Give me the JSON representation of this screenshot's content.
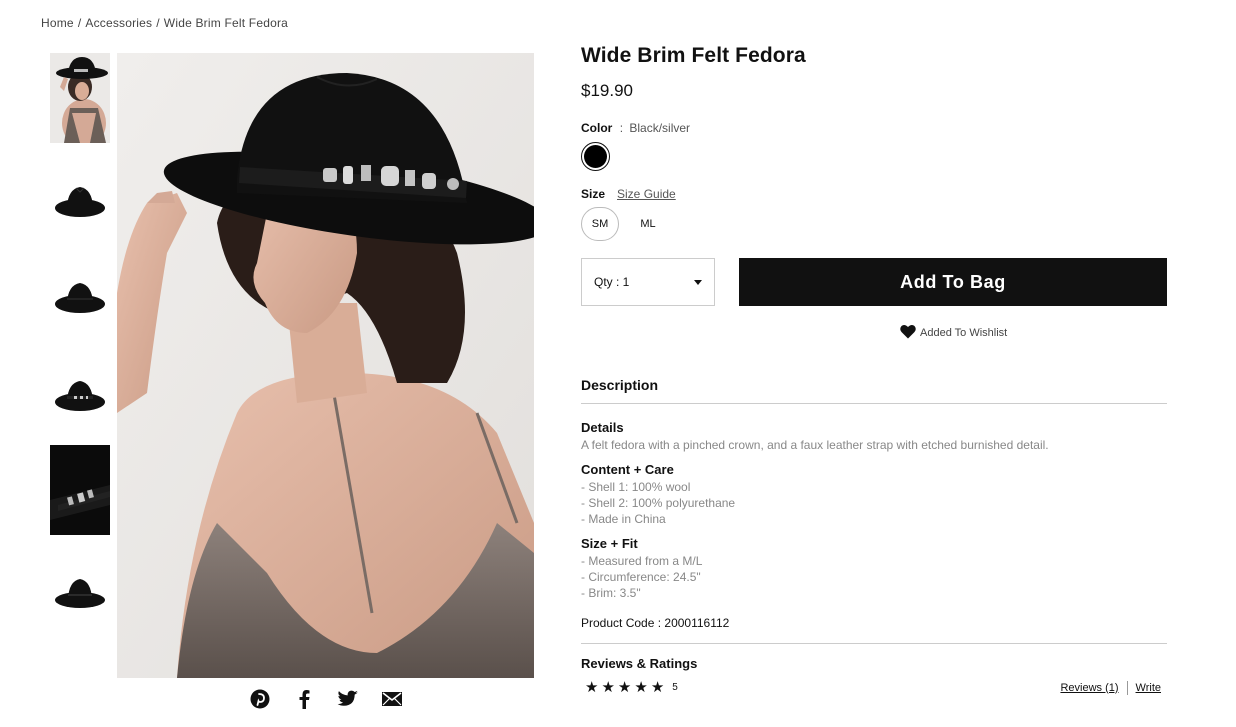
{
  "breadcrumb": {
    "items": [
      "Home",
      "Accessories",
      "Wide Brim Felt Fedora"
    ],
    "separator": "/"
  },
  "product": {
    "title": "Wide Brim Felt Fedora",
    "price": "$19.90",
    "color_label": "Color",
    "color_sep": ":",
    "color_value": "Black/silver",
    "swatch_color": "#000000",
    "size_label": "Size",
    "size_guide": "Size Guide",
    "sizes": [
      "SM",
      "ML"
    ],
    "selected_size": "SM",
    "qty_label": "Qty : 1",
    "add_to_bag": "Add To Bag",
    "wishlist": "Added To Wishlist"
  },
  "description": {
    "heading": "Description",
    "details_title": "Details",
    "details_text": "A felt fedora with a pinched crown, and a faux leather strap with etched burnished detail.",
    "care_title": "Content + Care",
    "care_items": [
      "- Shell 1: 100% wool",
      "- Shell 2: 100% polyurethane",
      "- Made in China"
    ],
    "fit_title": "Size + Fit",
    "fit_items": [
      "- Measured from a M/L",
      "- Circumference: 24.5\"",
      "- Brim: 3.5\""
    ],
    "product_code_label": "Product Code :",
    "product_code": "2000116112"
  },
  "reviews": {
    "heading": "Reviews & Ratings",
    "stars": 5,
    "count": "5",
    "reviews_link": "Reviews (1)",
    "write_link": "Write"
  },
  "share": {
    "icons": [
      "pinterest-icon",
      "facebook-icon",
      "twitter-icon",
      "email-icon"
    ]
  },
  "colors": {
    "accent": "#111111",
    "muted_text": "#888888",
    "divider": "#cccccc"
  }
}
